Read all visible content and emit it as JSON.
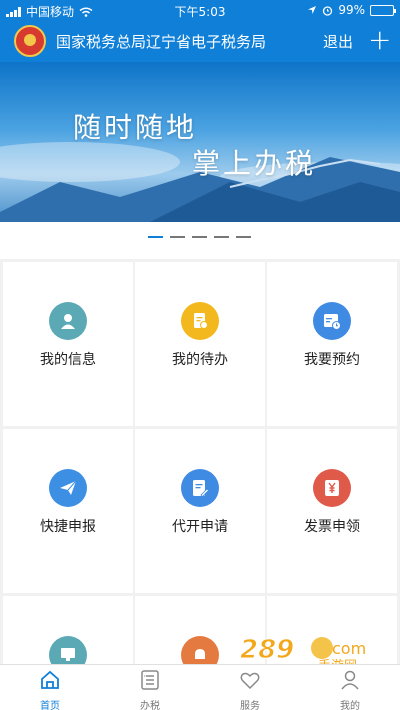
{
  "status_bar": {
    "carrier": "中国移动",
    "time": "下午5:03",
    "battery": "99%"
  },
  "header": {
    "title": "国家税务总局辽宁省电子税务局",
    "logout": "退出"
  },
  "banner": {
    "line1": "随时随地",
    "line2": "掌上办税"
  },
  "grid": {
    "items": [
      {
        "label": "我的信息",
        "color": "#5aa9b5"
      },
      {
        "label": "我的待办",
        "color": "#f2b81d"
      },
      {
        "label": "我要预约",
        "color": "#3f8be3"
      },
      {
        "label": "快捷申报",
        "color": "#3d8fe4"
      },
      {
        "label": "代开申请",
        "color": "#3f8be3"
      },
      {
        "label": "发票申领",
        "color": "#e05a4a"
      },
      {
        "label": "",
        "color": "#5aa9b5"
      },
      {
        "label": "",
        "color": "#e47a3f"
      }
    ]
  },
  "bottom_nav": {
    "items": [
      {
        "label": "首页",
        "active": true
      },
      {
        "label": "办税",
        "active": false
      },
      {
        "label": "服务",
        "active": false
      },
      {
        "label": "我的",
        "active": false
      }
    ]
  },
  "watermark": {
    "number": "289",
    "text": "手游网",
    "suffix": "com"
  },
  "colors": {
    "primary": "#0f7fd8",
    "background": "#f1f1f1"
  }
}
